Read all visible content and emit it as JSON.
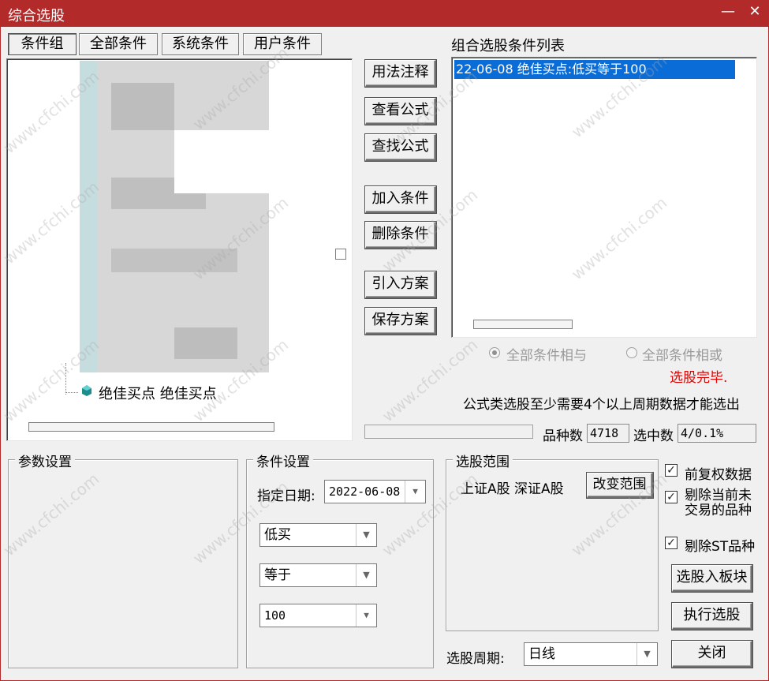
{
  "window": {
    "title": "综合选股",
    "min_label": "—",
    "close_label": "✕"
  },
  "tabs": [
    {
      "label": "条件组"
    },
    {
      "label": "全部条件"
    },
    {
      "label": "系统条件"
    },
    {
      "label": "用户条件"
    }
  ],
  "tree": {
    "visible_item": "绝佳买点  绝佳买点"
  },
  "side_buttons": {
    "usage_note": "用法注释",
    "view_formula": "查看公式",
    "find_formula": "查找公式",
    "add_condition": "加入条件",
    "delete_condition": "删除条件",
    "import_scheme": "引入方案",
    "save_scheme": "保存方案"
  },
  "condition_list": {
    "title": "组合选股条件列表",
    "items": [
      "22-06-08  绝佳买点:低买等于100"
    ],
    "selected_index": 0
  },
  "logic": {
    "and_label": "全部条件相与",
    "or_label": "全部条件相或",
    "selected": "and"
  },
  "status": {
    "done_text": "选股完毕.",
    "done_color": "#e00000",
    "note": "公式类选股至少需要4个以上周期数据才能选出",
    "count_label": "品种数",
    "count_value": "4718",
    "selected_label": "选中数",
    "selected_value": "4/0.1%"
  },
  "params": {
    "legend": "参数设置"
  },
  "condition_settings": {
    "legend": "条件设置",
    "date_label": "指定日期:",
    "date_value": "2022-06-08",
    "field1": "低买",
    "operator": "等于",
    "value": "100"
  },
  "range": {
    "legend": "选股范围",
    "text": "上证A股  深证A股",
    "change_button": "改变范围"
  },
  "options": {
    "adjusted": {
      "label": "前复权数据",
      "checked": true
    },
    "exclude_untraded": {
      "label": "剔除当前未交易的品种",
      "checked": true
    },
    "exclude_st": {
      "label": "剔除ST品种",
      "checked": true
    }
  },
  "period": {
    "label": "选股周期:",
    "value": "日线"
  },
  "actions": {
    "to_block": "选股入板块",
    "execute": "执行选股",
    "close": "关闭"
  },
  "watermark": "www.cfchi.com",
  "colors": {
    "title_bar": "#b32a2a",
    "selection": "#0a6cd6"
  }
}
